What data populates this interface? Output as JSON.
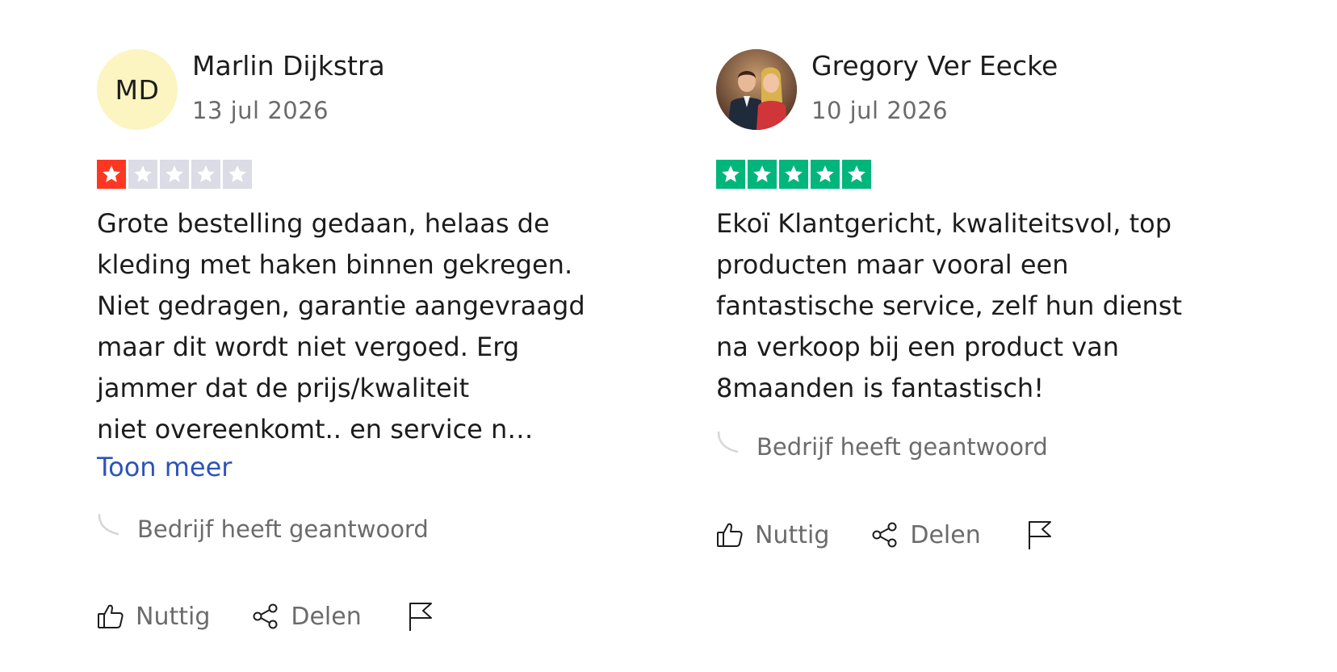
{
  "reviews": [
    {
      "reviewer_name": "Marlin Dijkstra",
      "initials": "MD",
      "avatar_type": "initials",
      "date": "13 jul 2026",
      "rating": 1,
      "rating_color": "#ff3722",
      "text_lines": [
        "Grote bestelling gedaan, helaas de",
        "kleding met haken binnen gekregen.",
        "Niet gedragen, garantie aangevraagd",
        "maar dit wordt niet vergoed. Erg",
        "jammer dat de prijs/kwaliteit",
        "niet overeenkomt.. en service n…"
      ],
      "show_more": "Toon meer",
      "company_reply": "Bedrijf heeft geantwoord",
      "useful_label": "Nuttig",
      "share_label": "Delen",
      "icons": {
        "useful": "thumbs-up-icon",
        "share": "share-icon",
        "report": "flag-icon",
        "reply": "reply-curve-icon"
      }
    },
    {
      "reviewer_name": "Gregory Ver Eecke",
      "avatar_type": "photo",
      "date": "10 jul 2026",
      "rating": 5,
      "rating_color": "#00b67a",
      "text_lines": [
        "Ekoï Klantgericht, kwaliteitsvol, top",
        "producten maar vooral een",
        "fantastische service, zelf hun dienst",
        "na verkoop bij een product van",
        "8maanden is fantastisch!"
      ],
      "company_reply": "Bedrijf heeft geantwoord",
      "useful_label": "Nuttig",
      "share_label": "Delen",
      "icons": {
        "useful": "thumbs-up-icon",
        "share": "share-icon",
        "report": "flag-icon",
        "reply": "reply-curve-icon"
      }
    }
  ],
  "colors": {
    "empty_star": "#dcdce6",
    "link": "#2c54b8",
    "muted_text": "#6b6b6b",
    "initials_bg": "#fcf4c1"
  }
}
